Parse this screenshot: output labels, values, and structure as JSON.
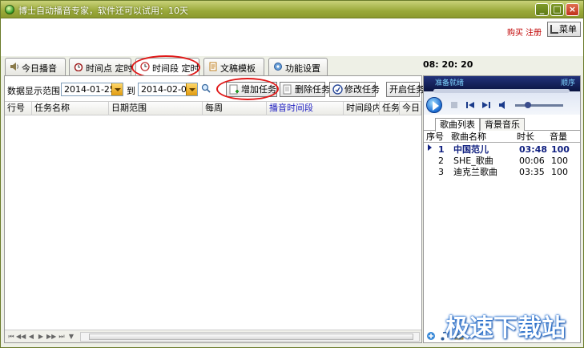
{
  "window": {
    "title": "博士自动播音专家，软件还可以试用：10天",
    "min_glyph": "_",
    "max_glyph": "□",
    "close_glyph": "×"
  },
  "header": {
    "buy_register": "购买 注册",
    "menu_label": "菜单",
    "clock": "08: 20: 20"
  },
  "tabs": [
    {
      "label": "今日播音",
      "icon": "speaker-icon"
    },
    {
      "label": "时间点 定时",
      "icon": "alarm-clock-icon"
    },
    {
      "label": "时间段 定时",
      "icon": "clock-icon",
      "active": true
    },
    {
      "label": "文稿模板",
      "icon": "document-icon"
    },
    {
      "label": "功能设置",
      "icon": "gear-icon"
    }
  ],
  "filter": {
    "label": "数据显示范围:",
    "start_date": "2014-01-25",
    "to_label": "到",
    "end_date": "2014-02-01"
  },
  "toolbar": {
    "add": "增加任务",
    "delete": "删除任务",
    "edit": "修改任务",
    "start": "开启任务"
  },
  "table": {
    "columns": [
      "行号",
      "任务名称",
      "日期范围",
      "每周",
      "播音时间段",
      "时间段内",
      "任务",
      "今日"
    ]
  },
  "player": {
    "status": "准备就绪",
    "mode": "顺序"
  },
  "playlist": {
    "tabs": [
      "歌曲列表",
      "背景音乐"
    ],
    "columns": [
      "序号",
      "歌曲名称",
      "时长",
      "音量"
    ],
    "rows": [
      {
        "no": "1",
        "name": "中国范儿",
        "duration": "03:48",
        "volume": "100",
        "current": true
      },
      {
        "no": "2",
        "name": "SHE_歌曲",
        "duration": "00:06",
        "volume": "100"
      },
      {
        "no": "3",
        "name": "迪克兰歌曲",
        "duration": "03:35",
        "volume": "100"
      }
    ]
  },
  "watermark": "极速下载站",
  "colors": {
    "titlebar": "#9aa93a",
    "highlight_circle": "#e01818",
    "current_song": "#102080"
  }
}
